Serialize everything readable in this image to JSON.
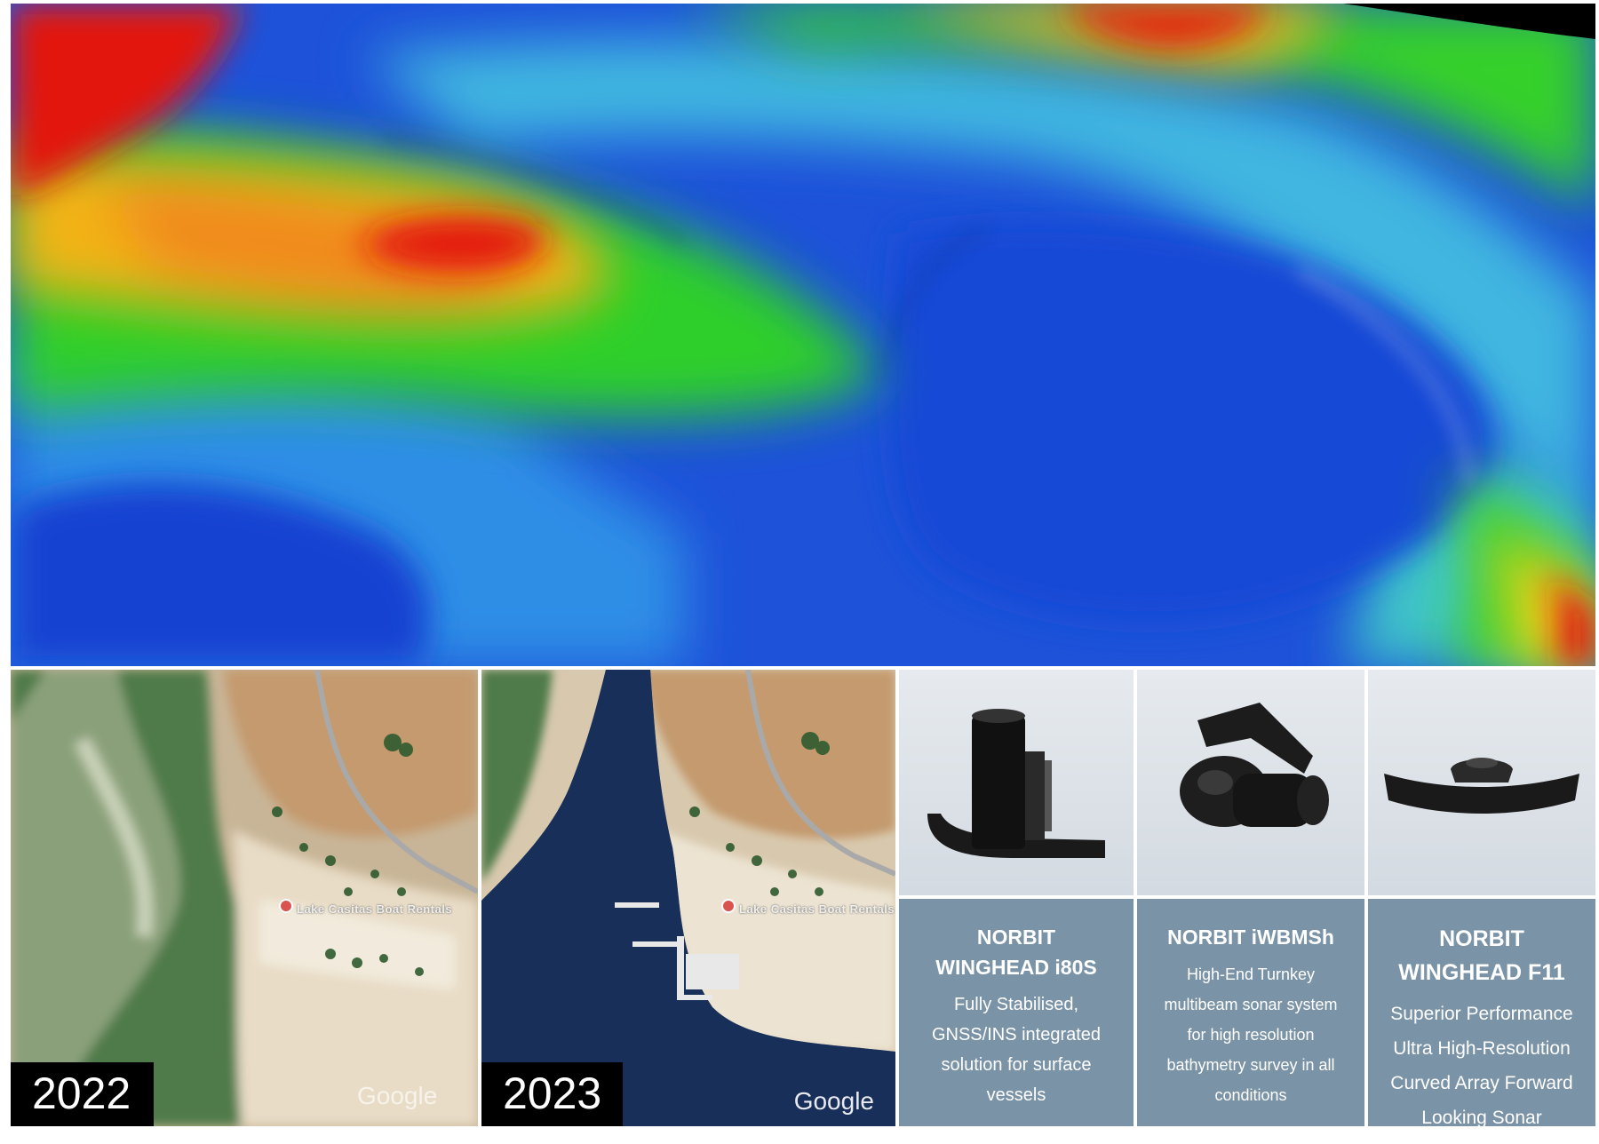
{
  "satellite": {
    "year_2022": "2022",
    "year_2023": "2023",
    "watermark": "Google",
    "place": "Lake Casitas Boat Rentals"
  },
  "products": [
    {
      "title_line1": "NORBIT",
      "title_line2": "WINGHEAD i80S",
      "description": [
        "Fully Stabilised,",
        "GNSS/INS integrated",
        "solution for surface",
        "vessels"
      ]
    },
    {
      "title_line1": "NORBIT iWBMSh",
      "description": [
        "High-End Turnkey",
        "multibeam sonar system",
        "for high resolution",
        "bathymetry survey in all",
        "conditions"
      ]
    },
    {
      "title_line1": "NORBIT",
      "title_line2": "WINGHEAD F11",
      "description": [
        "Superior Performance",
        "Ultra High-Resolution",
        "Curved Array Forward",
        "Looking Sonar"
      ]
    }
  ],
  "colors": {
    "card_body": "#7a93a6",
    "card_image_bg": "#dde3e8",
    "depth_shallow": "#e01010",
    "depth_mid": "#25c81a",
    "depth_deep": "#1a47d8"
  }
}
